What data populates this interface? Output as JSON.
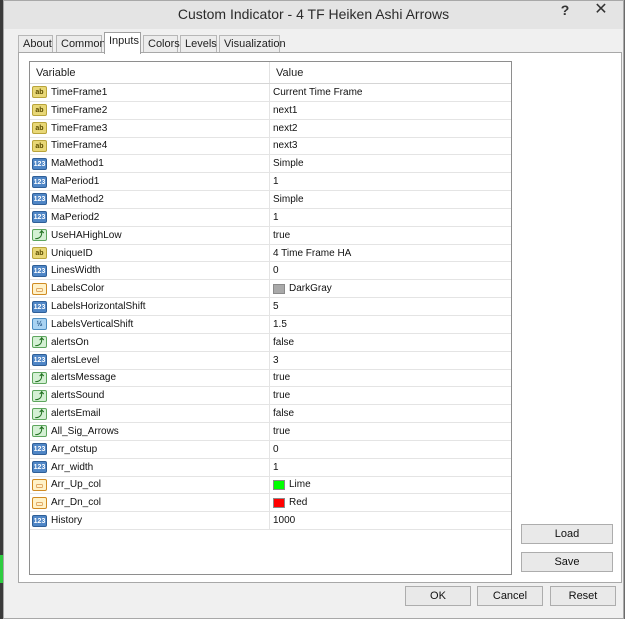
{
  "window": {
    "title": "Custom Indicator - 4 TF Heiken Ashi Arrows",
    "help_label": "?",
    "close_label": "✕"
  },
  "tabs": [
    {
      "label": "About"
    },
    {
      "label": "Common"
    },
    {
      "label": "Inputs",
      "active": true
    },
    {
      "label": "Colors"
    },
    {
      "label": "Levels"
    },
    {
      "label": "Visualization"
    }
  ],
  "grid": {
    "columns": {
      "variable": "Variable",
      "value": "Value"
    },
    "rows": [
      {
        "variable": "TimeFrame1",
        "value": "Current Time Frame",
        "icon": "string-icon"
      },
      {
        "variable": "TimeFrame2",
        "value": "next1",
        "icon": "string-icon"
      },
      {
        "variable": "TimeFrame3",
        "value": "next2",
        "icon": "string-icon"
      },
      {
        "variable": "TimeFrame4",
        "value": "next3",
        "icon": "string-icon"
      },
      {
        "variable": "MaMethod1",
        "value": "Simple",
        "icon": "integer-icon"
      },
      {
        "variable": "MaPeriod1",
        "value": "1",
        "icon": "integer-icon"
      },
      {
        "variable": "MaMethod2",
        "value": "Simple",
        "icon": "integer-icon"
      },
      {
        "variable": "MaPeriod2",
        "value": "1",
        "icon": "integer-icon"
      },
      {
        "variable": "UseHAHighLow",
        "value": "true",
        "icon": "bool-icon"
      },
      {
        "variable": "UniqueID",
        "value": "4 Time Frame HA",
        "icon": "string-icon"
      },
      {
        "variable": "LinesWidth",
        "value": "0",
        "icon": "integer-icon"
      },
      {
        "variable": "LabelsColor",
        "value": "DarkGray",
        "icon": "color-icon",
        "swatch": "#a9a9a9"
      },
      {
        "variable": "LabelsHorizontalShift",
        "value": "5",
        "icon": "integer-icon"
      },
      {
        "variable": "LabelsVerticalShift",
        "value": "1.5",
        "icon": "double-icon"
      },
      {
        "variable": "alertsOn",
        "value": "false",
        "icon": "bool-icon"
      },
      {
        "variable": "alertsLevel",
        "value": "3",
        "icon": "integer-icon"
      },
      {
        "variable": "alertsMessage",
        "value": "true",
        "icon": "bool-icon"
      },
      {
        "variable": "alertsSound",
        "value": "true",
        "icon": "bool-icon"
      },
      {
        "variable": "alertsEmail",
        "value": "false",
        "icon": "bool-icon"
      },
      {
        "variable": "All_Sig_Arrows",
        "value": "true",
        "icon": "bool-icon"
      },
      {
        "variable": "Arr_otstup",
        "value": "0",
        "icon": "integer-icon"
      },
      {
        "variable": "Arr_width",
        "value": "1",
        "icon": "integer-icon"
      },
      {
        "variable": "Arr_Up_col",
        "value": "Lime",
        "icon": "color-icon",
        "swatch": "#00ff00"
      },
      {
        "variable": "Arr_Dn_col",
        "value": "Red",
        "icon": "color-icon",
        "swatch": "#ff0000"
      },
      {
        "variable": "History",
        "value": "1000",
        "icon": "integer-icon"
      }
    ]
  },
  "buttons": {
    "load": "Load",
    "save": "Save",
    "ok": "OK",
    "cancel": "Cancel",
    "reset": "Reset"
  }
}
